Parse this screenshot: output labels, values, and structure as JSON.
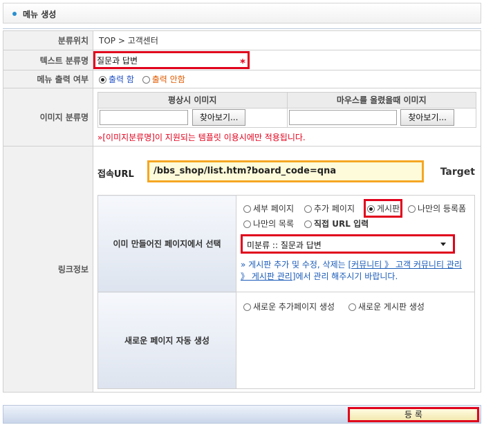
{
  "header": {
    "title": "메뉴 생성"
  },
  "rows": {
    "location": {
      "label": "분류위치",
      "value": "TOP > 고객센터"
    },
    "text_category": {
      "label": "텍스트 분류명",
      "value": "질문과 답변",
      "required_mark": "*"
    },
    "menu_output": {
      "label": "메뉴 출력 여부",
      "option_on": "출력 함",
      "option_off": "출력 안함",
      "selected": "on"
    },
    "image_category": {
      "label": "이미지 분류명",
      "col_normal": "평상시 이미지",
      "col_hover": "마우스를 올렸을때 이미지",
      "browse_label": "찾아보기...",
      "note": "»[이미지분류명]이 지원되는 템플릿 이용시에만 적용됩니다."
    },
    "link_info": {
      "label": "링크정보",
      "url_label": "접속URL",
      "url_value": "/bbs_shop/list.htm?board_code=qna",
      "target_label": "Target",
      "existing_page": {
        "label": "이미 만들어진 페이지에서 선택",
        "options": [
          "세부 페이지",
          "추가 페이지",
          "게시판",
          "나만의 등록폼",
          "나만의 목록",
          "직접 URL 입력"
        ],
        "selected": "게시판",
        "select_value": "미분류 :: 질문과 답변",
        "help_prefix": "» 게시판 추가 및 수정, 삭제는 ",
        "help_link": "[커뮤니티 》 고객 커뮤니티 관리 》 게시판 관리]",
        "help_suffix": "에서 관리 해주시기 바랍니다."
      },
      "new_page": {
        "label": "새로운 페이지 자동 생성",
        "options": [
          "새로운 추가페이지 생성",
          "새로운 게시판 생성"
        ]
      }
    }
  },
  "footer": {
    "submit_label": "등 록"
  },
  "colors": {
    "highlight_red": "#e0001b",
    "highlight_orange": "#f5a623",
    "accent_blue": "#2a8fd0"
  }
}
